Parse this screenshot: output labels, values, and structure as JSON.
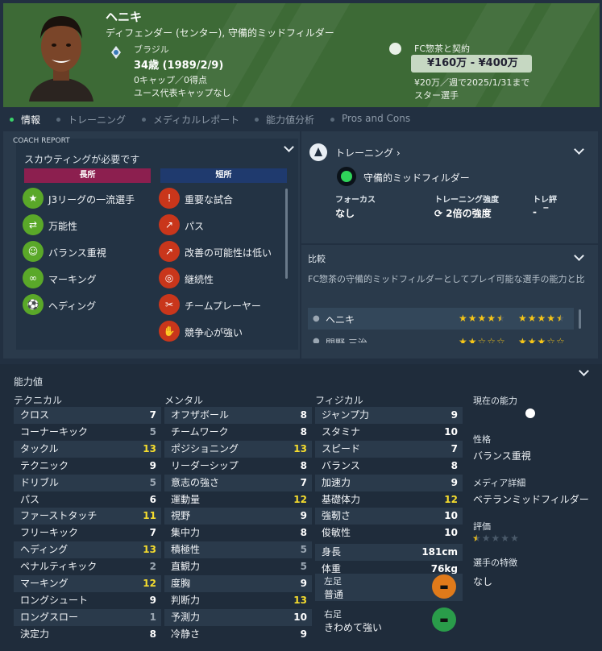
{
  "player": {
    "name": "ヘニキ",
    "positions": "ディフェンダー (センター), 守備的ミッドフィルダー",
    "nation": "ブラジル",
    "age": "34歳 (1989/2/9)",
    "caps": "0キャップ／0得点",
    "youth": "ユース代表キャップなし",
    "club": "FC惣茶と契約",
    "value": "¥160万 - ¥400万",
    "wage": "¥20万／週で2025/1/31まで",
    "status": "スター選手"
  },
  "tabs": [
    "情報",
    "トレーニング",
    "メディカルレポート",
    "能力値分析",
    "Pros and Cons"
  ],
  "coach_report": {
    "title": "COACH REPORT",
    "note": "スカウティングが必要です",
    "strengths_header": "長所",
    "weaknesses_header": "短所",
    "strengths": [
      "J3リーグの一流選手",
      "万能性",
      "バランス重視",
      "マーキング",
      "ヘディング"
    ],
    "weaknesses": [
      "重要な試合",
      "パス",
      "改善の可能性は低い",
      "継続性",
      "チームプレーヤー",
      "競争心が強い"
    ]
  },
  "training": {
    "title": "トレーニング",
    "role": "守備的ミッドフィルダー",
    "focus_label": "フォーカス",
    "focus_value": "なし",
    "intensity_label": "トレーニング強度",
    "intensity_value": "2倍の強度",
    "rating_label": "トレ評",
    "rating_value": "-"
  },
  "comparison": {
    "title": "比較",
    "desc": "FC惣茶の守備的ミッドフィルダーとしてプレイ可能な選手の能力と比",
    "row1_name": "ヘニキ",
    "row1_stars1": 4.5,
    "row1_stars2": 4.5,
    "row2_name": "関野 三治"
  },
  "attributes": {
    "title": "能力値",
    "technical_title": "テクニカル",
    "mental_title": "メンタル",
    "physical_title": "フィジカル",
    "technical": [
      [
        "クロス",
        "7"
      ],
      [
        "コーナーキック",
        "5"
      ],
      [
        "タックル",
        "13"
      ],
      [
        "テクニック",
        "9"
      ],
      [
        "ドリブル",
        "5"
      ],
      [
        "パス",
        "6"
      ],
      [
        "ファーストタッチ",
        "11"
      ],
      [
        "フリーキック",
        "7"
      ],
      [
        "ヘディング",
        "13"
      ],
      [
        "ペナルティキック",
        "2"
      ],
      [
        "マーキング",
        "12"
      ],
      [
        "ロングシュート",
        "9"
      ],
      [
        "ロングスロー",
        "1"
      ],
      [
        "決定力",
        "8"
      ]
    ],
    "mental": [
      [
        "オフザボール",
        "8"
      ],
      [
        "チームワーク",
        "8"
      ],
      [
        "ポジショニング",
        "13"
      ],
      [
        "リーダーシップ",
        "8"
      ],
      [
        "意志の強さ",
        "7"
      ],
      [
        "運動量",
        "12"
      ],
      [
        "視野",
        "9"
      ],
      [
        "集中力",
        "8"
      ],
      [
        "積極性",
        "5"
      ],
      [
        "直観力",
        "5"
      ],
      [
        "度胸",
        "9"
      ],
      [
        "判断力",
        "13"
      ],
      [
        "予測力",
        "10"
      ],
      [
        "冷静さ",
        "9"
      ]
    ],
    "physical": [
      [
        "ジャンプ力",
        "9"
      ],
      [
        "スタミナ",
        "10"
      ],
      [
        "スピード",
        "7"
      ],
      [
        "バランス",
        "8"
      ],
      [
        "加速力",
        "9"
      ],
      [
        "基礎体力",
        "12"
      ],
      [
        "強靭さ",
        "10"
      ],
      [
        "俊敏性",
        "10"
      ]
    ],
    "height_label": "身長",
    "height": "181cm",
    "weight_label": "体重",
    "weight": "76kg",
    "left_foot_label": "左足",
    "left_foot": "普通",
    "right_foot_label": "右足",
    "right_foot": "きわめて強い"
  },
  "side": {
    "current_ability_label": "現在の能力",
    "personality_label": "性格",
    "personality": "バランス重視",
    "media_label": "メディア詳細",
    "media": "ベテランミッドフィルダー",
    "rating_label": "評価",
    "rating_stars": 0.5,
    "traits_label": "選手の特徴",
    "traits": "なし"
  },
  "colors": {
    "header_green": "#3d6a36",
    "highlight": "#f5dc2e",
    "strength": "#8c1f4f",
    "weakness": "#1f3a6e",
    "green_icon": "#5aa829",
    "red_icon": "#c9361b"
  }
}
